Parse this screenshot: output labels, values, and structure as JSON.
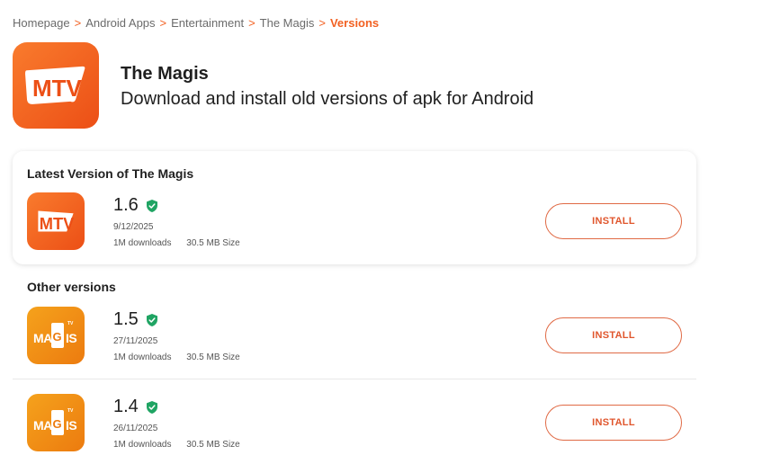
{
  "breadcrumb": [
    {
      "label": "Homepage",
      "current": false
    },
    {
      "label": "Android Apps",
      "current": false
    },
    {
      "label": "Entertainment",
      "current": false
    },
    {
      "label": "The Magis",
      "current": false
    },
    {
      "label": "Versions",
      "current": true
    }
  ],
  "breadcrumb_separator": ">",
  "app": {
    "title": "The Magis",
    "subtitle": "Download and install old versions of apk for Android",
    "icon_text": "MTV"
  },
  "latest": {
    "section_title": "Latest Version of The Magis",
    "version": "1.6",
    "date": "9/12/2025",
    "downloads": "1M downloads",
    "size": "30.5 MB Size",
    "icon": "mtv-logo",
    "install_label": "INSTALL"
  },
  "other": {
    "section_title": "Other versions",
    "versions": [
      {
        "version": "1.5",
        "date": "27/11/2025",
        "downloads": "1M downloads",
        "size": "30.5 MB Size",
        "icon": "magis-tv-logo",
        "install_label": "INSTALL"
      },
      {
        "version": "1.4",
        "date": "26/11/2025",
        "downloads": "1M downloads",
        "size": "30.5 MB Size",
        "icon": "magis-tv-logo",
        "install_label": "INSTALL"
      }
    ]
  },
  "colors": {
    "accent": "#f26122",
    "verified": "#1fa463",
    "mtv_icon": "#ec4f16",
    "magis_icon": "#ec7b0f"
  }
}
